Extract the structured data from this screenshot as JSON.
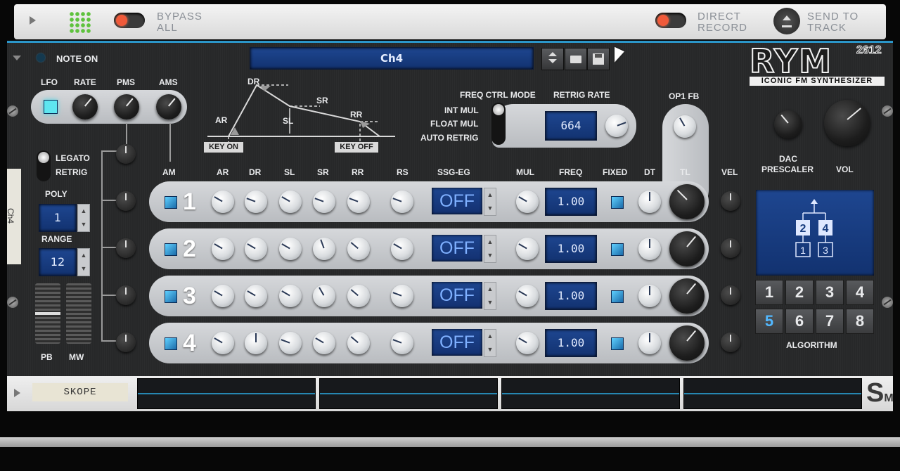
{
  "header": {
    "bypass_label_1": "BYPASS",
    "bypass_label_2": "ALL",
    "direct_label_1": "DIRECT",
    "direct_label_2": "RECORD",
    "send_label_1": "SEND TO",
    "send_label_2": "TRACK"
  },
  "device": {
    "note_on": "NOTE ON",
    "patch_name": "Ch4",
    "logo": "RYM",
    "logo_sup": "2612",
    "tagline": "ICONIC FM SYNTHESIZER",
    "side_tab": "Ch4"
  },
  "lfo": {
    "lfo": "LFO",
    "rate": "RATE",
    "pms": "PMS",
    "ams": "AMS"
  },
  "envelope": {
    "ar": "AR",
    "dr": "DR",
    "sl": "SL",
    "sr": "SR",
    "rr": "RR",
    "key_on": "KEY ON",
    "key_off": "KEY OFF"
  },
  "left": {
    "legato": "LEGATO",
    "retrig": "RETRIG",
    "poly": "POLY",
    "poly_value": "1",
    "range": "RANGE",
    "range_value": "12",
    "pb": "PB",
    "mw": "MW"
  },
  "freq_mode": {
    "title": "FREQ CTRL MODE",
    "int_mul": "INT MUL",
    "float_mul": "FLOAT MUL",
    "auto_retrig": "AUTO RETRIG",
    "retrig_rate": "RETRIG RATE",
    "retrig_value": "664"
  },
  "op_headers": {
    "am": "AM",
    "ar": "AR",
    "dr": "DR",
    "sl": "SL",
    "sr": "SR",
    "rr": "RR",
    "rs": "RS",
    "ssg": "SSG-EG",
    "mul": "MUL",
    "freq": "FREQ",
    "fixed": "FIXED",
    "dt": "DT",
    "tl": "TL",
    "vel": "VEL",
    "op1fb": "OP1 FB"
  },
  "operators": [
    {
      "num": "1",
      "ssg": "OFF",
      "freq": "1.00"
    },
    {
      "num": "2",
      "ssg": "OFF",
      "freq": "1.00"
    },
    {
      "num": "3",
      "ssg": "OFF",
      "freq": "1.00"
    },
    {
      "num": "4",
      "ssg": "OFF",
      "freq": "1.00"
    }
  ],
  "right": {
    "dac_1": "DAC",
    "dac_2": "PRESCALER",
    "vol": "VOL",
    "algorithm": "ALGORITHM",
    "alg_buttons": [
      "1",
      "2",
      "3",
      "4",
      "5",
      "6",
      "7",
      "8"
    ],
    "alg_selected": "5",
    "alg_diagram": [
      "2",
      "4",
      "1",
      "3"
    ]
  },
  "bottom": {
    "skope": "SKOPE",
    "logo": "S",
    "logo_small": "M"
  },
  "colors": {
    "accent": "#2b96c9",
    "lcd": "#173c7e",
    "led_red": "#f05a3a"
  }
}
